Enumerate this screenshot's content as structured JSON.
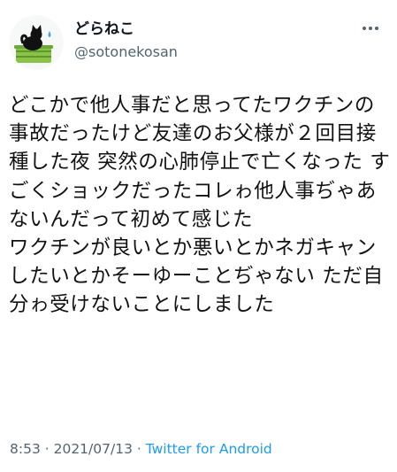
{
  "author": {
    "display_name": "どらねこ",
    "handle": "@sotonekosan",
    "avatar_icon": "cat-in-green-basket-icon",
    "more_icon": "more-options-icon"
  },
  "tweet": {
    "text": "どこかで他人事だと思ってたワクチンの事故だったけど友達のお父様が２回目接種した夜 突然の心肺停止で亡くなった すごくショックだったコレゎ他人事ぢゃあないんだって初めて感じた\nワクチンが良いとか悪いとかネガキャンしたいとかそーゆーことぢゃない ただ自分ゎ受けないことにしました"
  },
  "meta": {
    "time": "8:53",
    "separator": " · ",
    "date": "2021/07/13",
    "source": "Twitter for Android"
  },
  "colors": {
    "text": "#0f1419",
    "secondary": "#536471",
    "link": "#1d9bf0",
    "avatar_bg": "#f7f9f9",
    "basket_green": "#8bc34a"
  }
}
